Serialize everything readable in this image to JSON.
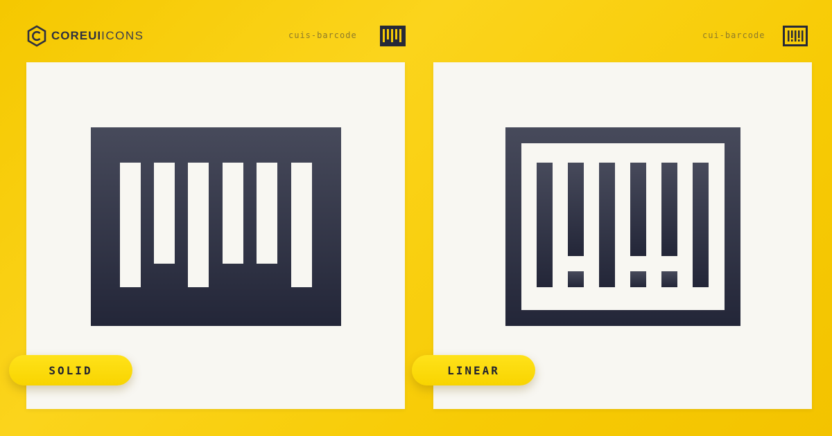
{
  "brand": {
    "core": "COREUI",
    "icons": "ICONS"
  },
  "solid": {
    "icon_name": "cuis-barcode",
    "style_label": "SOLID"
  },
  "linear": {
    "icon_name": "cui-barcode",
    "style_label": "LINEAR"
  },
  "colors": {
    "background": "#f7cb05",
    "card": "#f8f7f2",
    "icon_dark": "#262938",
    "icon_top": "#474a5b",
    "pill": "#fbd900"
  }
}
